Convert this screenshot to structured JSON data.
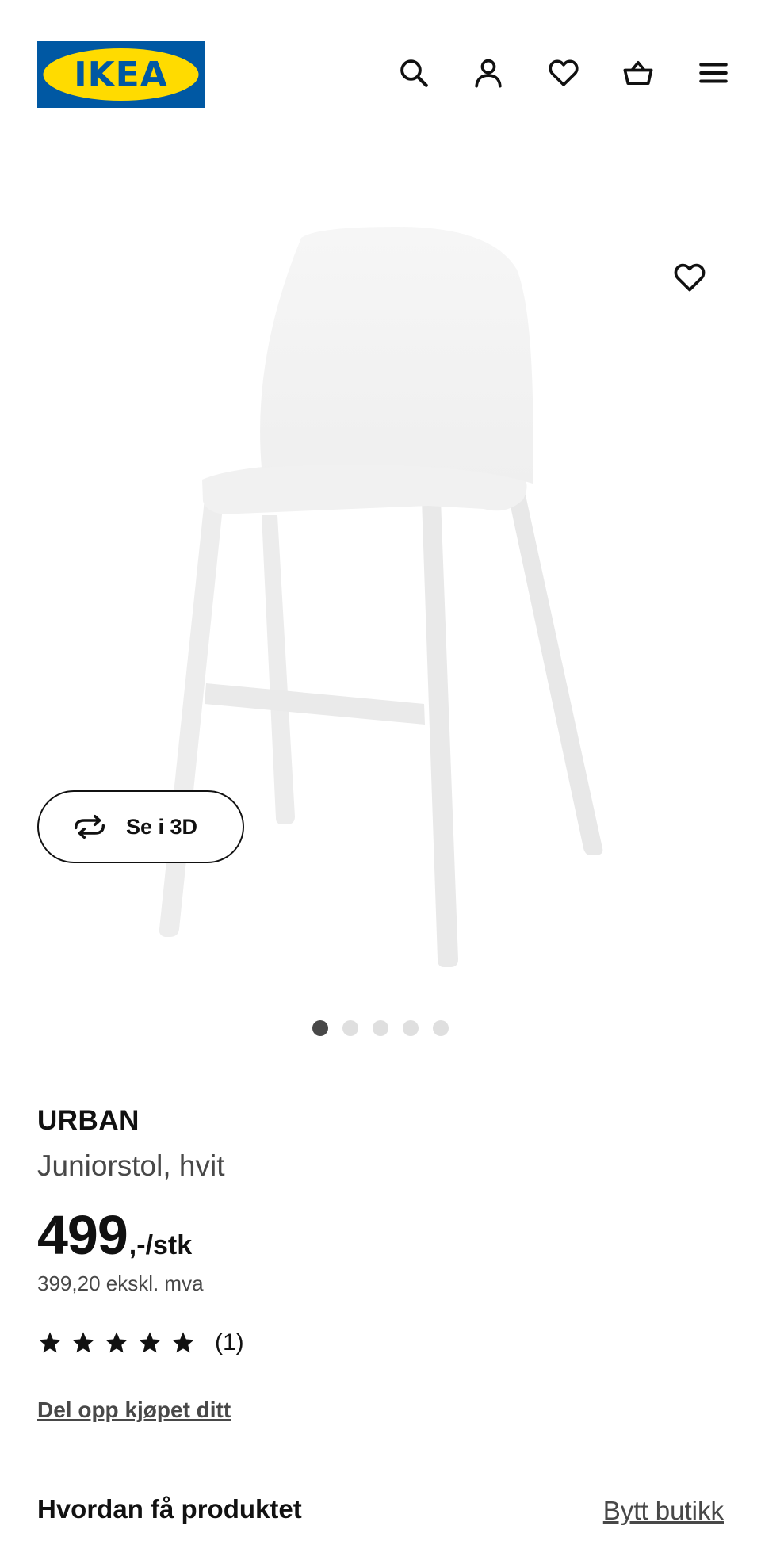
{
  "header": {
    "logo_text": "IKEA",
    "icons": [
      "search-icon",
      "account-icon",
      "heart-icon",
      "basket-icon",
      "menu-icon"
    ],
    "brand_colors": {
      "blue": "#0058a3",
      "yellow": "#ffdb00"
    }
  },
  "gallery": {
    "view_3d_label": "Se i 3D",
    "slide_count": 5,
    "active_slide": 1
  },
  "product": {
    "name": "URBAN",
    "description": "Juniorstol, hvit",
    "price": "499",
    "price_suffix": ",-/stk",
    "price_ex_vat": "399,20 ekskl. mva",
    "rating_stars": 5,
    "rating_count": "(1)",
    "split_purchase_link": "Del opp kjøpet ditt"
  },
  "fulfilment": {
    "title": "Hvordan få produktet",
    "change_store_link": "Bytt butikk"
  }
}
